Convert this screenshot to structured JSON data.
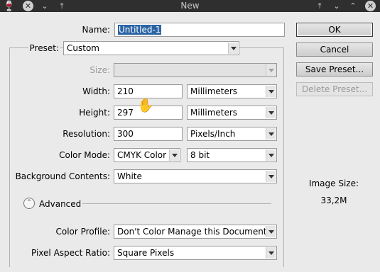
{
  "window": {
    "title": "New"
  },
  "name": {
    "label": "Name:",
    "value": "Untitled-1"
  },
  "preset": {
    "label": "Preset:",
    "value": "Custom"
  },
  "size": {
    "label": "Size:",
    "value": ""
  },
  "width": {
    "label": "Width:",
    "value": "210",
    "unit": "Millimeters"
  },
  "height": {
    "label": "Height:",
    "value": "297",
    "unit": "Millimeters"
  },
  "resolution": {
    "label": "Resolution:",
    "value": "300",
    "unit": "Pixels/Inch"
  },
  "color_mode": {
    "label": "Color Mode:",
    "value": "CMYK Color",
    "depth": "8 bit"
  },
  "background": {
    "label": "Background Contents:",
    "value": "White"
  },
  "advanced": {
    "label": "Advanced"
  },
  "color_profile": {
    "label": "Color Profile:",
    "value": "Don't Color Manage this Document"
  },
  "pixel_aspect": {
    "label": "Pixel Aspect Ratio:",
    "value": "Square Pixels"
  },
  "buttons": {
    "ok": "OK",
    "cancel": "Cancel",
    "save_preset": "Save Preset...",
    "delete_preset": "Delete Preset..."
  },
  "image_size": {
    "label": "Image Size:",
    "value": "33,2M"
  },
  "icons": {
    "app": "wine-glass-icon",
    "close": "close-icon",
    "menu": "chevron-down-icon",
    "pin": "keep-above-icon",
    "hand": "hand-cursor-icon"
  }
}
